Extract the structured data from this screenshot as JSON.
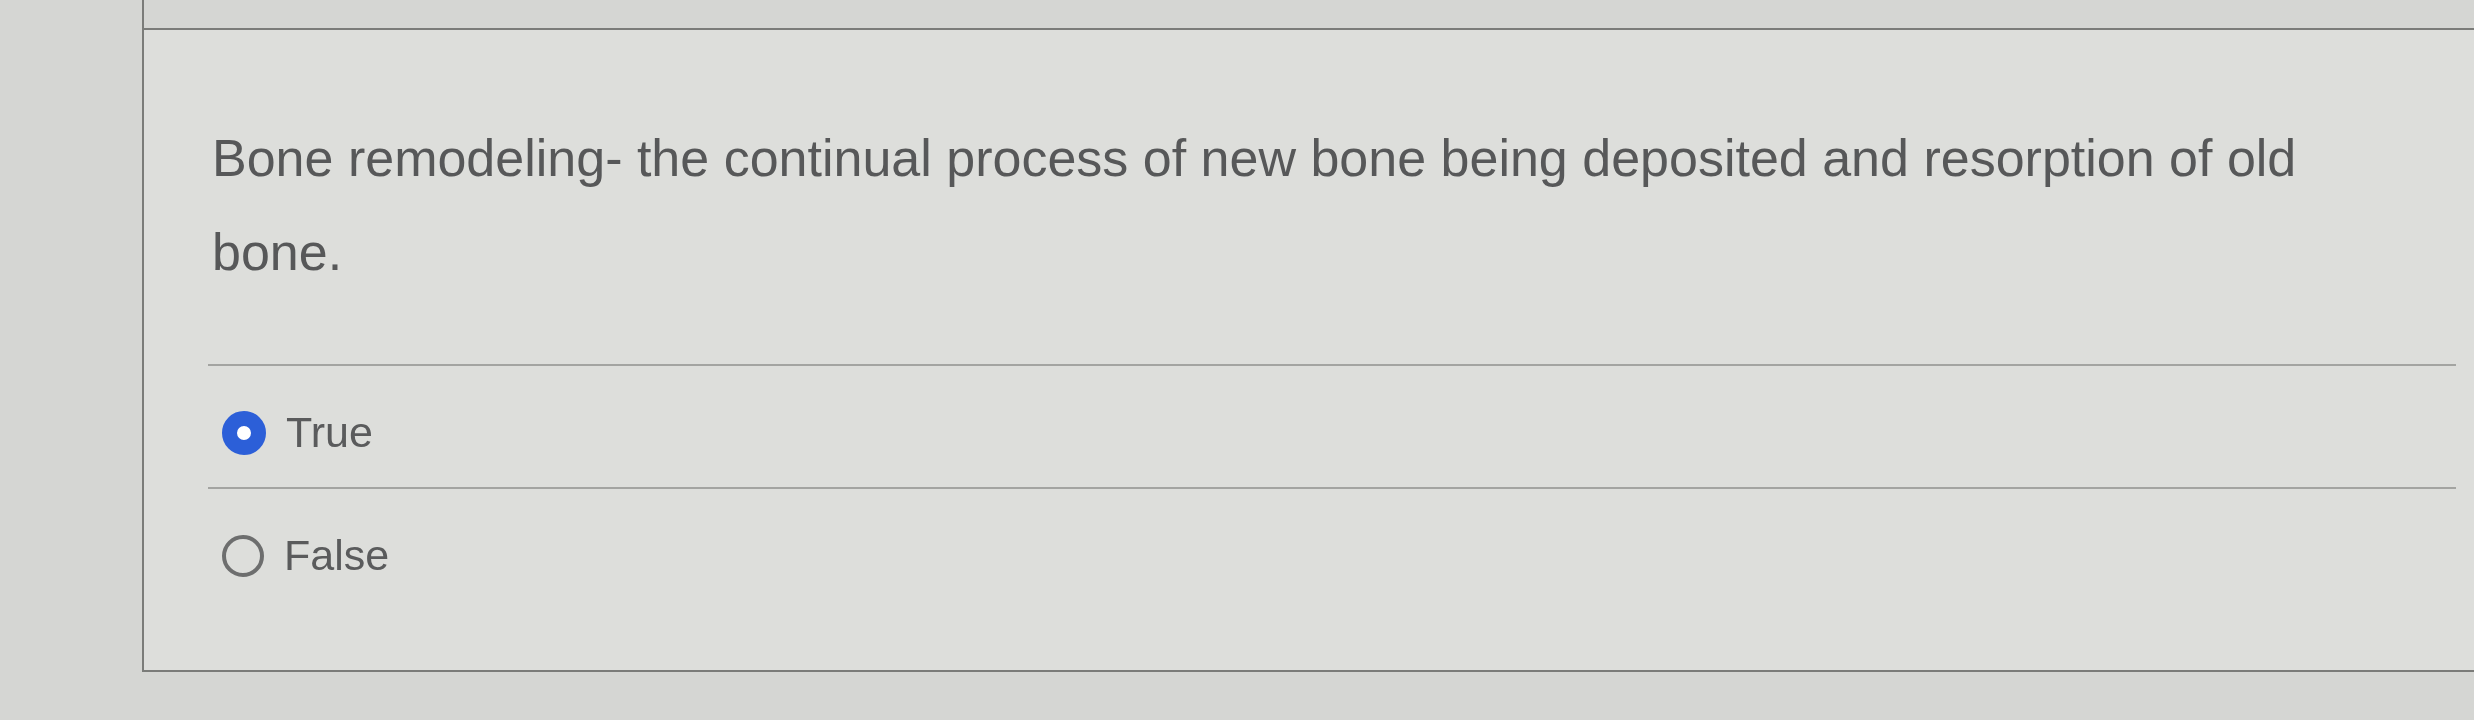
{
  "question": {
    "text": "Bone remodeling- the continual process of new bone being deposited and resorption of old bone."
  },
  "options": [
    {
      "label": "True",
      "selected": true
    },
    {
      "label": "False",
      "selected": false
    }
  ]
}
